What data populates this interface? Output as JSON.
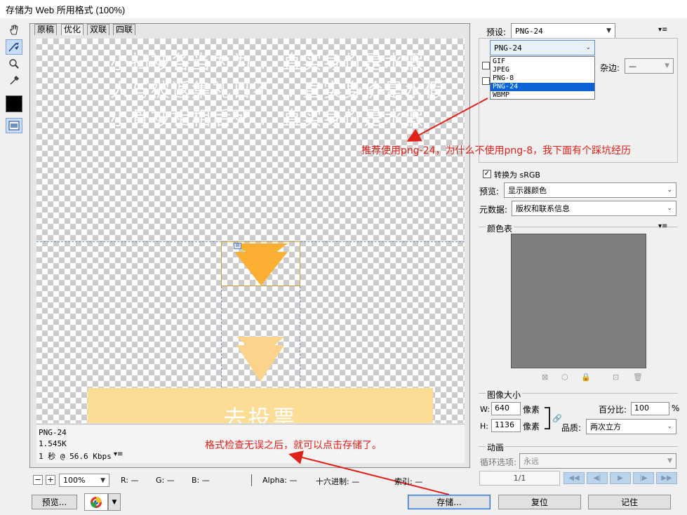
{
  "window": {
    "title": "存储为 Web 所用格式 (100%)"
  },
  "tools": [
    {
      "name": "hand-tool-icon",
      "glyph": "✋"
    },
    {
      "name": "slice-select-tool-icon",
      "glyph": "⬈"
    },
    {
      "name": "zoom-tool-icon",
      "glyph": "🔍"
    },
    {
      "name": "eyedropper-tool-icon",
      "glyph": "✎"
    }
  ],
  "tabs": [
    "原稿",
    "优化",
    "双联",
    "四联"
  ],
  "canvas": {
    "ghost_lines": [
      "小扫被各当为为...  直实身价是水假",
      "人与被返集礼日不...  直实身价是水假",
      "小骨被相相后死...  直实身价是水假"
    ],
    "button_text": "去投票",
    "arrow_color": "#fbb034",
    "arrow_light": "#fcd38a",
    "button_color": "#fddc95"
  },
  "info": {
    "format": "PNG-24",
    "size": "1.545K",
    "speed": "1 秒 @ 56.6 Kbps"
  },
  "annotations": {
    "top": "推荐使用png-24，为什么不使用png-8，我下面有个踩坑经历",
    "bottom": "格式检查无误之后，就可以点击存储了。"
  },
  "statusbar": {
    "zoom": "100%",
    "r_label": "R:",
    "r_value": "—",
    "g_label": "G:",
    "g_value": "—",
    "b_label": "B:",
    "b_value": "—",
    "alpha_label": "Alpha:",
    "alpha_value": "—",
    "hex_label": "十六进制:",
    "hex_value": "—",
    "index_label": "索引:",
    "index_value": "—"
  },
  "buttons": {
    "preview": "预览...",
    "save": "存储...",
    "reset": "复位",
    "remember": "记住"
  },
  "settings": {
    "preset_label": "预设:",
    "preset_value": "PNG-24",
    "format_value": "PNG-24",
    "format_options": [
      "GIF",
      "JPEG",
      "PNG-8",
      "PNG-24",
      "WBMP"
    ],
    "format_selected": "PNG-24",
    "matte_label": "杂边:",
    "matte_value": "—",
    "convert_srgb": "转换为 sRGB",
    "preview_label": "预览:",
    "preview_value": "显示器颜色",
    "metadata_label": "元数据:",
    "metadata_value": "版权和联系信息"
  },
  "color_table": {
    "title": "颜色表",
    "swatch": "#7f7f7f"
  },
  "image_size": {
    "title": "图像大小",
    "w_label": "W:",
    "w_value": "640",
    "w_unit": "像素",
    "h_label": "H:",
    "h_value": "1136",
    "h_unit": "像素",
    "percent_label": "百分比:",
    "percent_value": "100",
    "percent_unit": "%",
    "quality_label": "品质:",
    "quality_value": "两次立方"
  },
  "animation": {
    "title": "动画",
    "loop_label": "循环选项:",
    "loop_value": "永远",
    "frame": "1/1"
  }
}
